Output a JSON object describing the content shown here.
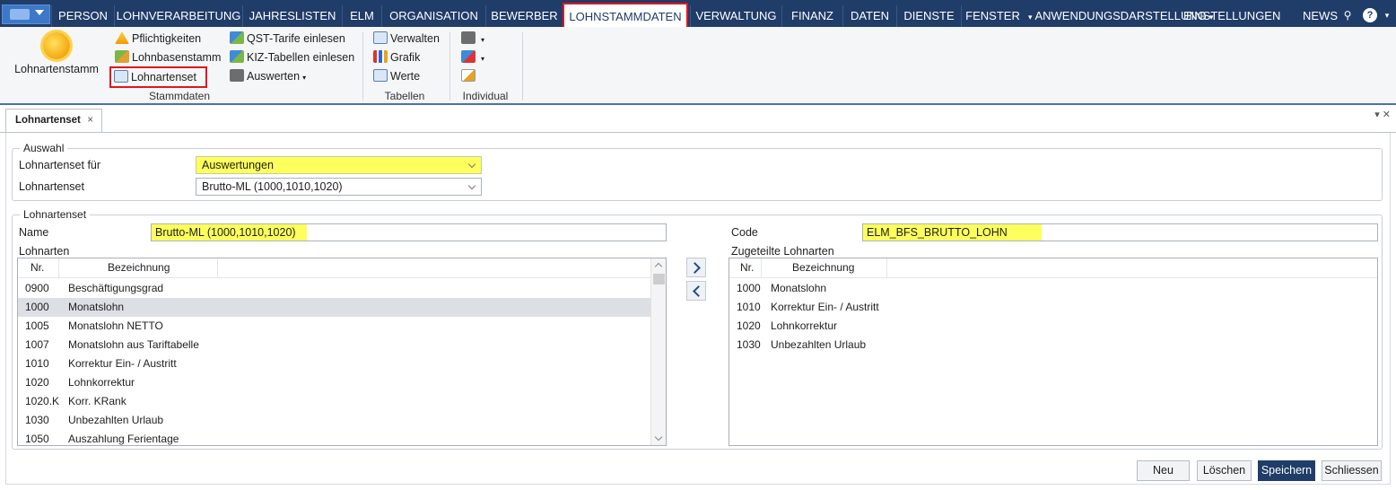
{
  "menubar": {
    "items": [
      "PERSON",
      "LOHNVERARBEITUNG",
      "JAHRESLISTEN",
      "ELM",
      "ORGANISATION",
      "BEWERBER",
      "LOHNSTAMMDATEN",
      "VERWALTUNG",
      "FINANZ",
      "DATEN",
      "DIENSTE",
      "FENSTER"
    ],
    "right_items": [
      "ANWENDUNGSDARSTELLUNG",
      "EINSTELLUNGEN",
      "NEWS"
    ],
    "active": "LOHNSTAMMDATEN",
    "search_icon": "magnifier-icon",
    "help_icon": "help-icon",
    "help_glyph": "?"
  },
  "ribbon": {
    "big_button": "Lohnartenstamm",
    "stammdaten": {
      "label": "Stammdaten",
      "items": [
        "Pflichtigkeiten",
        "Lohnbasenstamm",
        "Lohnartenset",
        "QST-Tarife einlesen",
        "KIZ-Tabellen einlesen",
        "Auswerten"
      ]
    },
    "tabellen": {
      "label": "Tabellen",
      "items": [
        "Verwalten",
        "Grafik",
        "Werte"
      ]
    },
    "individual": {
      "label": "Individual"
    }
  },
  "tab": {
    "title": "Lohnartenset",
    "close": "×"
  },
  "auswahl": {
    "legend": "Auswahl",
    "set_fuer_label": "Lohnartenset für",
    "set_fuer_value": "Auswertungen",
    "set_label": "Lohnartenset",
    "set_value": "Brutto-ML (1000,1010,1020)"
  },
  "lohnartenset": {
    "legend": "Lohnartenset",
    "name_label": "Name",
    "name_value": "Brutto-ML (1000,1010,1020)",
    "code_label": "Code",
    "code_value": "ELM_BFS_BRUTTO_LOHN",
    "lohnarten_label": "Lohnarten",
    "zugeteilt_label": "Zugeteilte Lohnarten",
    "col_nr": "Nr.",
    "col_bez": "Bezeichnung",
    "lohnarten": [
      {
        "nr": "0900",
        "bez": "Beschäftigungsgrad"
      },
      {
        "nr": "1000",
        "bez": "Monatslohn"
      },
      {
        "nr": "1005",
        "bez": "Monatslohn NETTO"
      },
      {
        "nr": "1007",
        "bez": "Monatslohn aus Tariftabelle"
      },
      {
        "nr": "1010",
        "bez": "Korrektur Ein- / Austritt"
      },
      {
        "nr": "1020",
        "bez": "Lohnkorrektur"
      },
      {
        "nr": "1020.K",
        "bez": "Korr. KRank"
      },
      {
        "nr": "1030",
        "bez": "Unbezahlten Urlaub"
      },
      {
        "nr": "1050",
        "bez": "Auszahlung Ferientage"
      }
    ],
    "selected_index": 1,
    "zugeteilt": [
      {
        "nr": "1000",
        "bez": "Monatslohn"
      },
      {
        "nr": "1010",
        "bez": "Korrektur Ein- / Austritt"
      },
      {
        "nr": "1020",
        "bez": "Lohnkorrektur"
      },
      {
        "nr": "1030",
        "bez": "Unbezahlten Urlaub"
      }
    ]
  },
  "buttons": {
    "neu": "Neu",
    "loeschen": "Löschen",
    "speichern": "Speichern",
    "schliessen": "Schliessen"
  },
  "colors": {
    "menubar": "#203c68",
    "highlight_yellow": "#fdff5c",
    "active_outline": "#e0161d",
    "primary_button": "#1f3d68"
  }
}
